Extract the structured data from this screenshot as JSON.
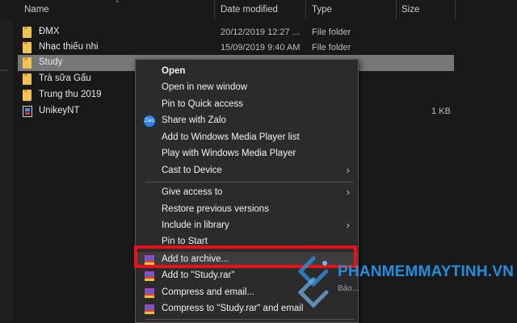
{
  "columns": {
    "name": "Name",
    "date": "Date modified",
    "type": "Type",
    "size": "Size"
  },
  "files": [
    {
      "name": "ĐMX",
      "date": "20/12/2019 12:27 ...",
      "type": "File folder",
      "size": "",
      "icon": "folder-icon"
    },
    {
      "name": "Nhạc thiếu nhi",
      "date": "15/09/2019 9:40 AM",
      "type": "File folder",
      "size": "",
      "icon": "folder-icon"
    },
    {
      "name": "Study",
      "date": "",
      "type": "",
      "size": "",
      "icon": "folder-icon",
      "selected": true
    },
    {
      "name": "Trà sữa Gấu",
      "date": "",
      "type": "",
      "size": "",
      "icon": "folder-icon"
    },
    {
      "name": "Trung thu 2019",
      "date": "",
      "type": "",
      "size": "",
      "icon": "folder-icon"
    },
    {
      "name": "UnikeyNT",
      "date": "",
      "type": "",
      "size": "1 KB",
      "icon": "shortcut-exe-icon"
    }
  ],
  "menu": {
    "open": "Open",
    "open_new_window": "Open in new window",
    "pin_quick_access": "Pin to Quick access",
    "share_zalo": "Share with Zalo",
    "zalo_icon_text": "Zalo",
    "add_wmp_list": "Add to Windows Media Player list",
    "play_wmp": "Play with Windows Media Player",
    "cast_device": "Cast to Device",
    "give_access": "Give access to",
    "restore_versions": "Restore previous versions",
    "include_library": "Include in library",
    "pin_start": "Pin to Start",
    "add_archive": "Add to archive...",
    "add_study_rar": "Add to \"Study.rar\"",
    "compress_email": "Compress and email...",
    "compress_study_email": "Compress to \"Study.rar\" and email"
  },
  "watermark": {
    "brand": "PHANMEMMAYTINH.VN",
    "tagline": "Báo..."
  },
  "colors": {
    "highlight_box": "#e8121b",
    "brand": "#1f8fe0",
    "selection": "#777777"
  }
}
